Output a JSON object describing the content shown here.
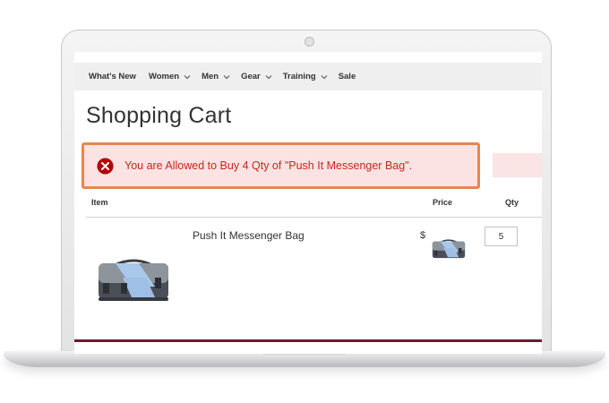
{
  "nav": {
    "items": [
      {
        "label": "What's New",
        "dropdown": false
      },
      {
        "label": "Women",
        "dropdown": true
      },
      {
        "label": "Men",
        "dropdown": true
      },
      {
        "label": "Gear",
        "dropdown": true
      },
      {
        "label": "Training",
        "dropdown": true
      },
      {
        "label": "Sale",
        "dropdown": false
      }
    ]
  },
  "page": {
    "title": "Shopping Cart"
  },
  "error": {
    "icon": "error-circle-icon",
    "message": "You are Allowed to Buy 4 Qty of \"Push It Messenger Bag\".",
    "text_color": "#c8261f",
    "border_color": "#e8864f",
    "background_color": "#fbe3e3"
  },
  "cart": {
    "columns": {
      "item": "Item",
      "price": "Price",
      "qty": "Qty"
    },
    "rows": [
      {
        "name": "Push It Messenger Bag",
        "price_fragment": "$",
        "qty": "5",
        "image": "messenger-bag-image"
      }
    ]
  },
  "colors": {
    "accent_bar": "#6e1a2e",
    "nav_bg": "#efefef"
  }
}
